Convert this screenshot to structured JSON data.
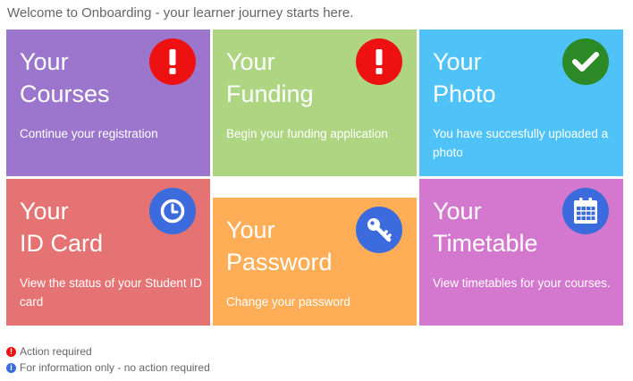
{
  "welcome": "Welcome to Onboarding - your learner journey starts here.",
  "tiles": {
    "courses": {
      "line1": "Your",
      "line2": "Courses",
      "desc": "Continue your registration",
      "icon": "exclamation-icon",
      "color": "#9b76cc"
    },
    "funding": {
      "line1": "Your",
      "line2": "Funding",
      "desc": "Begin your funding application",
      "icon": "exclamation-icon",
      "color": "#aed581"
    },
    "photo": {
      "line1": "Your",
      "line2": "Photo",
      "desc": "You have succesfully uploaded a photo",
      "icon": "checkmark-icon",
      "color": "#4fc3f7"
    },
    "idcard": {
      "line1": "Your",
      "line2": "ID Card",
      "desc": "View the status of your Student ID card",
      "icon": "clock-icon",
      "color": "#e57373"
    },
    "password": {
      "line1": "Your",
      "line2": "Password",
      "desc": "Change your password",
      "icon": "key-icon",
      "color": "#ffad57"
    },
    "timetable": {
      "line1": "Your",
      "line2": "Timetable",
      "desc": "View timetables for your courses.",
      "icon": "calendar-icon",
      "color": "#d477cf"
    }
  },
  "legend": {
    "action": {
      "glyph": "!",
      "text": "Action required",
      "color": "#ee1111"
    },
    "info": {
      "glyph": "i",
      "text": "For information only - no action required",
      "color": "#3b6bdc"
    }
  }
}
